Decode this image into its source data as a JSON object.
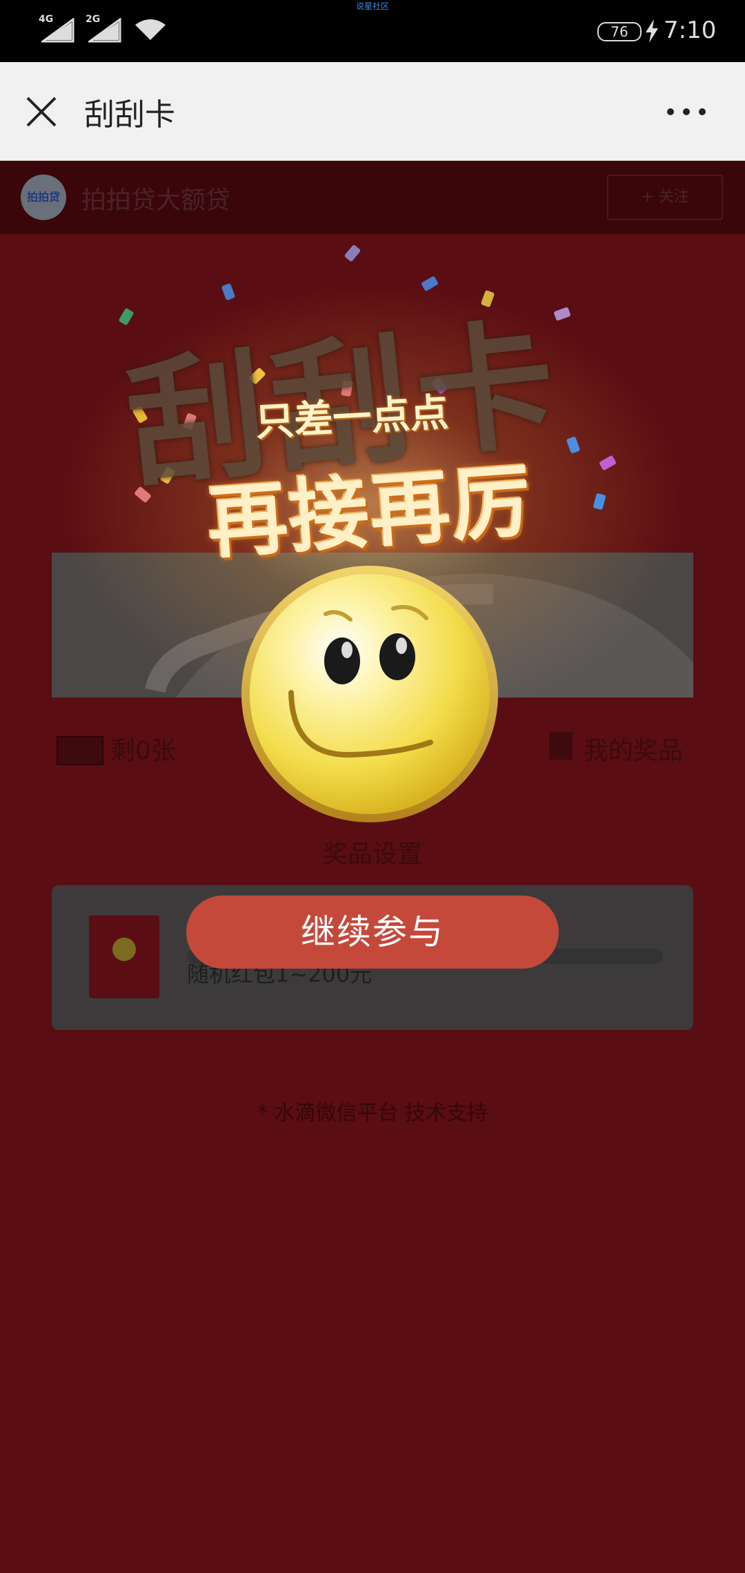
{
  "status_bar": {
    "network_1": "4G",
    "network_2": "2G",
    "top_label": "说星社区",
    "battery": "76",
    "time": "7:10"
  },
  "title_bar": {
    "title": "刮刮卡",
    "close_icon": "close-icon",
    "more_icon": "more-dots-icon"
  },
  "page": {
    "account_name": "拍拍贷大额贷",
    "logo_text": "拍拍贷",
    "follow_label": "+ 关注",
    "cards_left": "剩0张",
    "my_prizes": "我的奖品",
    "prize_heading": "奖品设置",
    "prize_name": "随机红包1~200元",
    "footer": "* 水滴微信平台 技术支持"
  },
  "popup": {
    "background_word": "刮刮卡",
    "subtitle": "只差一点点",
    "headline": "再接再厉",
    "continue_label": "继续参与",
    "icon": "smiley-face-icon"
  },
  "colors": {
    "status_bar": "#000000",
    "title_bar": "#f1f1f1",
    "page_dim": "#5a0d12",
    "button": "#c4493a"
  }
}
